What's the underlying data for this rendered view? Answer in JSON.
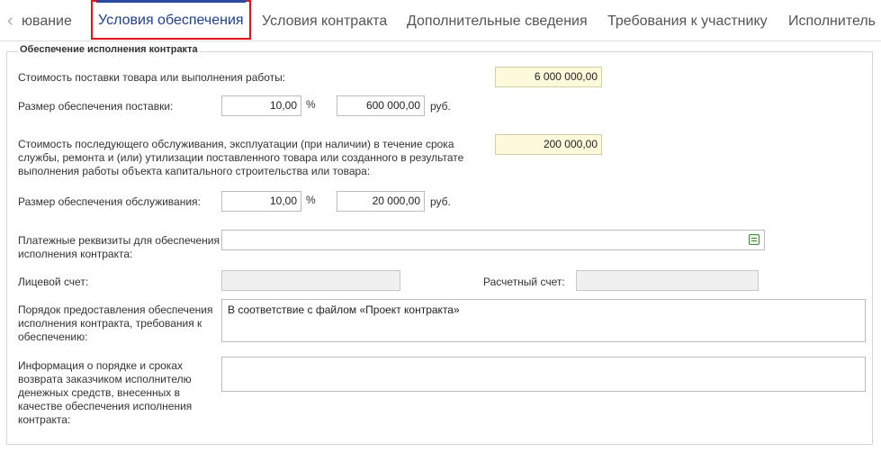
{
  "tabs": {
    "prev_partial": "ювание",
    "items": [
      "Условия обеспечения",
      "Условия контракта",
      "Дополнительные сведения",
      "Требования к участнику",
      "Исполнитель"
    ],
    "active": "Условия обеспечения"
  },
  "section": {
    "title": "Обеспечение исполнения контракта",
    "supply_cost_label": "Стоимость поставки товара или выполнения работы:",
    "supply_cost_value": "6 000 000,00",
    "supply_security_label": "Размер обеспечения поставки:",
    "supply_security_percent": "10,00",
    "supply_security_amount": "600 000,00",
    "service_cost_label": "Стоимость последующего обслуживания, эксплуатации (при наличии) в течение срока службы, ремонта и (или) утилизации поставленного товара или созданного в результате выполнения работы объекта капитального строительства или товара:",
    "service_cost_value": "200 000,00",
    "service_security_label": "Размер обеспечения обслуживания:",
    "service_security_percent": "10,00",
    "service_security_amount": "20 000,00",
    "percent_unit": "%",
    "currency_unit": "руб.",
    "payment_details_label": "Платежные реквизиты для обеспечения исполнения контракта:",
    "payment_details_value": "",
    "personal_account_label": "Лицевой счет:",
    "personal_account_value": "",
    "settlement_account_label": "Расчетный счет:",
    "settlement_account_value": "",
    "procedure_label": "Порядок предоставления обеспечения исполнения контракта, требования к обеспечению:",
    "procedure_value": "В соответствие с файлом «Проект контракта»",
    "refund_label": "Информация о порядке и сроках возврата заказчиком исполнителю денежных средств, внесенных в качестве обеспечения исполнения контракта:",
    "refund_value": ""
  }
}
